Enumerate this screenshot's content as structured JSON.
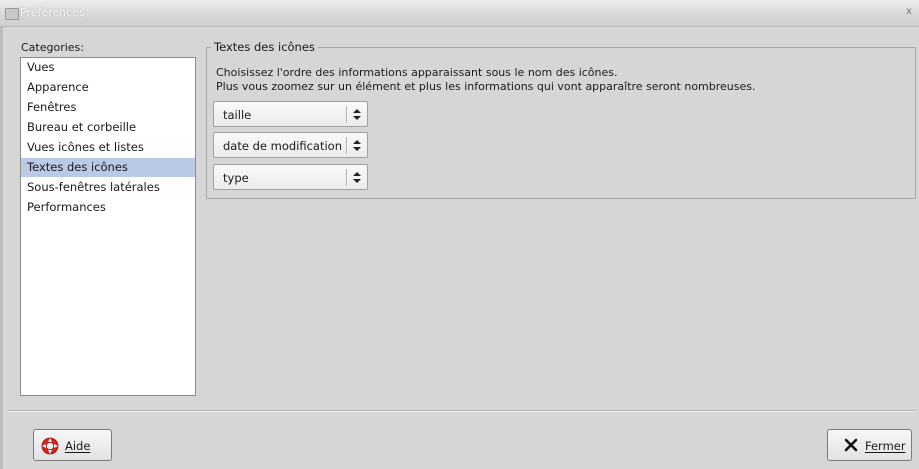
{
  "window": {
    "title": "Préférences",
    "close_glyph": "x"
  },
  "categories": {
    "label": "Categories:",
    "items": [
      {
        "label": "Vues",
        "selected": false
      },
      {
        "label": "Apparence",
        "selected": false
      },
      {
        "label": "Fenêtres",
        "selected": false
      },
      {
        "label": "Bureau et corbeille",
        "selected": false
      },
      {
        "label": "Vues icônes et listes",
        "selected": false
      },
      {
        "label": "Textes des icônes",
        "selected": true
      },
      {
        "label": "Sous-fenêtres latérales",
        "selected": false
      },
      {
        "label": "Performances",
        "selected": false
      }
    ]
  },
  "icon_text": {
    "group_title": "Textes des icônes",
    "description_line1": "Choisissez l'ordre des informations apparaissant sous le nom des icônes.",
    "description_line2": "Plus vous zoomez sur un élément et plus les informations qui vont apparaître seront nombreuses.",
    "combos": [
      {
        "value": "taille"
      },
      {
        "value": "date de modification"
      },
      {
        "value": "type"
      }
    ]
  },
  "footer": {
    "help_label": "Aide",
    "close_label": "Fermer",
    "help_icon": "lifebuoy-icon",
    "close_icon": "x-icon"
  },
  "colors": {
    "selection": "#b9c9e6",
    "background": "#d6d6d6",
    "help_icon_red": "#d8241a"
  }
}
